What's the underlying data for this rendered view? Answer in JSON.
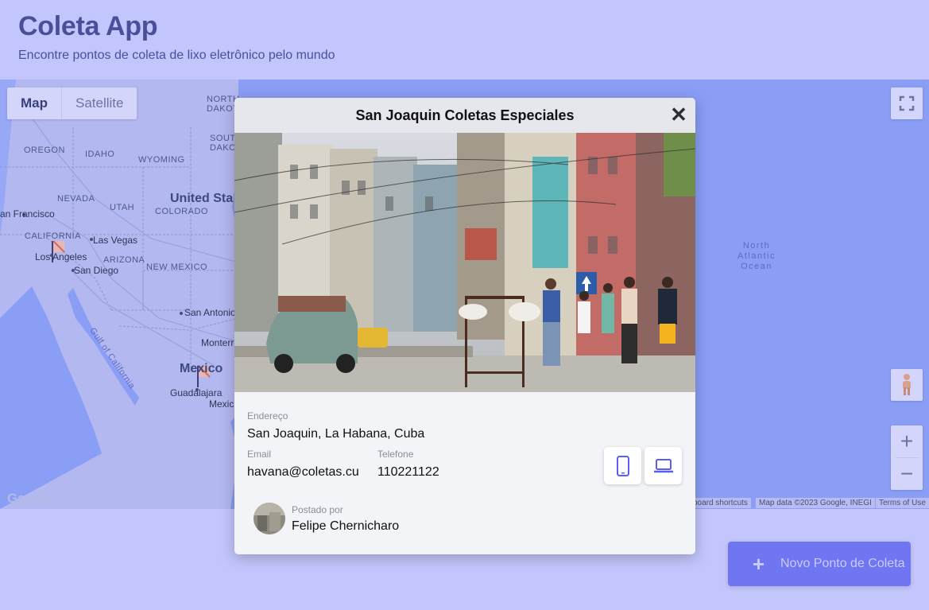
{
  "header": {
    "title": "Coleta App",
    "subtitle": "Encontre pontos de coleta de lixo eletrônico pelo mundo"
  },
  "map": {
    "map_type": {
      "map_label": "Map",
      "satellite_label": "Satellite",
      "selected": "Map"
    },
    "labels": {
      "north_dakota": "NORTH\nDAKOTA",
      "south_dakota": "SOUTH\nDAKOTA",
      "oregon": "OREGON",
      "idaho": "IDAHO",
      "wyoming": "WYOMING",
      "nevada": "NEVADA",
      "utah": "UTAH",
      "colorado": "COLORADO",
      "united_states": "United Sta",
      "san_francisco": "an Francisco",
      "california": "CALIFORNIA",
      "las_vegas": "Las Vegas",
      "los_angeles": "Los Angeles",
      "arizona": "ARIZONA",
      "new_mexico": "NEW MEXICO",
      "san_diego": "San Diego",
      "san_antonio": "San Antonio",
      "gulf_california": "Gulf of California",
      "monterrey": "Monterre",
      "mexico": "Mexico",
      "guadalajara": "Guadalajara",
      "mexico_city": "Mexic",
      "north_atlantic": "North\nAtlantic\nOcean"
    },
    "attribution": {
      "shortcuts": "board shortcuts",
      "map_data": "Map data ©2023 Google, INEGI",
      "terms": "Terms of Use"
    },
    "google_logo": "Google",
    "icons": {
      "fullscreen": "fullscreen-icon",
      "pegman": "pegman-icon",
      "zoom_in": "zoom-in-icon",
      "zoom_out": "zoom-out-icon",
      "marker": "flag-marker-icon"
    },
    "colors": {
      "water": "#8a9ef6",
      "land": "#b4b8f0"
    }
  },
  "modal": {
    "title": "San Joaquin Coletas Especiales",
    "address_label": "Endereço",
    "address": "San Joaquin, La Habana, Cuba",
    "email_label": "Email",
    "email": "havana@coletas.cu",
    "phone_label": "Telefone",
    "phone": "110221122",
    "poster_label": "Postado por",
    "poster_name": "Felipe Chernicharo",
    "icons": {
      "close": "close-icon",
      "phone": "smartphone-icon",
      "web": "laptop-icon"
    }
  },
  "new_point_button": {
    "label": "Novo Ponto de Coleta",
    "color": "#7075f1"
  }
}
